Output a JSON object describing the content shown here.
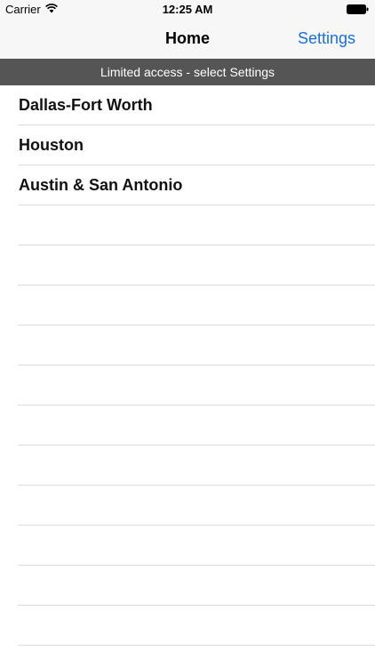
{
  "status_bar": {
    "carrier": "Carrier",
    "time": "12:25 AM",
    "wifi_icon": "wifi-icon",
    "battery_icon": "battery-icon"
  },
  "nav": {
    "title": "Home",
    "settings_label": "Settings",
    "accent_color": "#1a6fd6"
  },
  "banner": {
    "text": "Limited access - select Settings",
    "background": "#555555"
  },
  "list": {
    "items": [
      "Dallas-Fort Worth",
      "Houston",
      "Austin & San Antonio"
    ]
  }
}
